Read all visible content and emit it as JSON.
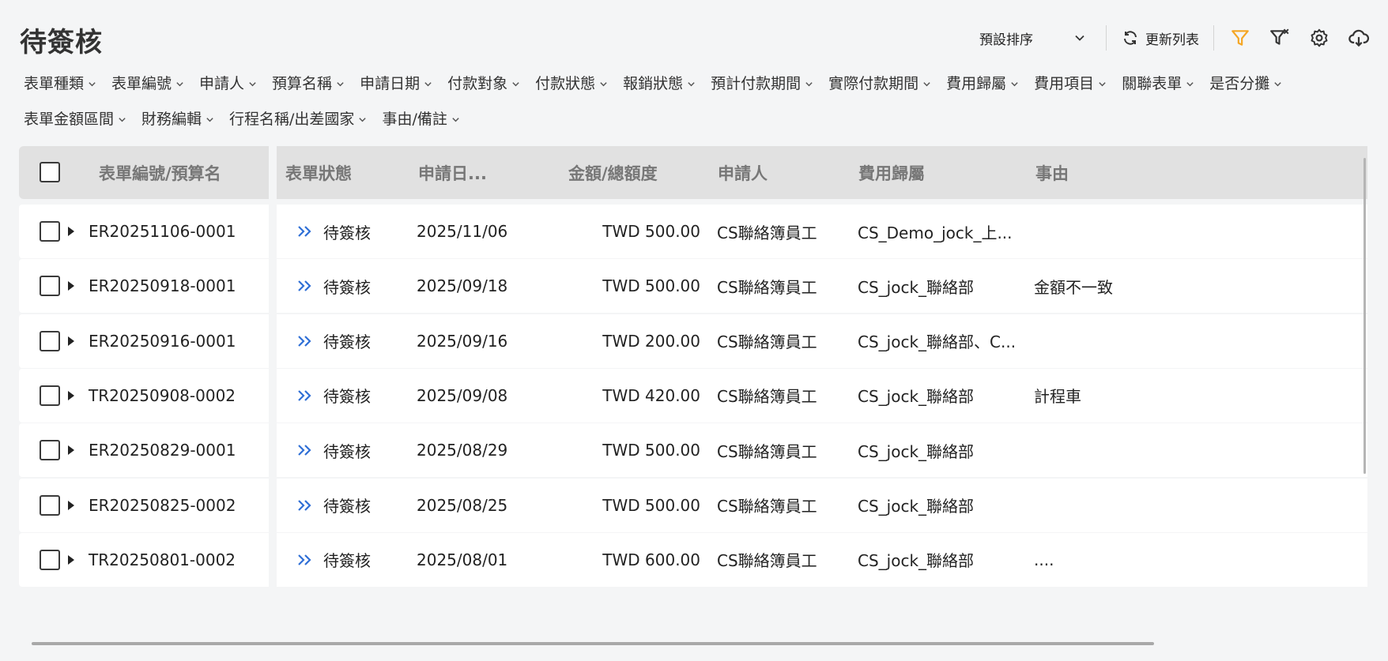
{
  "page": {
    "title": "待簽核"
  },
  "toolbar": {
    "sort_label": "預設排序",
    "refresh_label": "更新列表",
    "icons": [
      "filter-icon",
      "clear-filter-icon",
      "gear-icon",
      "cloud-download-icon"
    ],
    "accent_color": "#f5a623"
  },
  "filters": [
    "表單種類",
    "表單編號",
    "申請人",
    "預算名稱",
    "申請日期",
    "付款對象",
    "付款狀態",
    "報銷狀態",
    "預計付款期間",
    "實際付款期間",
    "費用歸屬",
    "費用項目",
    "關聯表單",
    "是否分攤",
    "表單金額區間",
    "財務編輯",
    "行程名稱/出差國家",
    "事由/備註"
  ],
  "table": {
    "headers": {
      "form_no": "表單編號/預算名",
      "status": "表單狀態",
      "date": "申請日...",
      "amount": "金額/總額度",
      "applicant": "申請人",
      "cost_center": "費用歸屬",
      "reason": "事由"
    },
    "rows": [
      {
        "form_no": "ER20251106-0001",
        "status": "待簽核",
        "date": "2025/11/06",
        "amount": "TWD 500.00",
        "applicant": "CS聯絡簿員工",
        "cost_center": "CS_Demo_jock_上...",
        "reason": ""
      },
      {
        "form_no": "ER20250918-0001",
        "status": "待簽核",
        "date": "2025/09/18",
        "amount": "TWD 500.00",
        "applicant": "CS聯絡簿員工",
        "cost_center": "CS_jock_聯絡部",
        "reason": "金額不一致"
      },
      {
        "form_no": "ER20250916-0001",
        "status": "待簽核",
        "date": "2025/09/16",
        "amount": "TWD 200.00",
        "applicant": "CS聯絡簿員工",
        "cost_center": "CS_jock_聯絡部、C...",
        "reason": ""
      },
      {
        "form_no": "TR20250908-0002",
        "status": "待簽核",
        "date": "2025/09/08",
        "amount": "TWD 420.00",
        "applicant": "CS聯絡簿員工",
        "cost_center": "CS_jock_聯絡部",
        "reason": "計程車"
      },
      {
        "form_no": "ER20250829-0001",
        "status": "待簽核",
        "date": "2025/08/29",
        "amount": "TWD 500.00",
        "applicant": "CS聯絡簿員工",
        "cost_center": "CS_jock_聯絡部",
        "reason": ""
      },
      {
        "form_no": "ER20250825-0002",
        "status": "待簽核",
        "date": "2025/08/25",
        "amount": "TWD 500.00",
        "applicant": "CS聯絡簿員工",
        "cost_center": "CS_jock_聯絡部",
        "reason": ""
      },
      {
        "form_no": "TR20250801-0002",
        "status": "待簽核",
        "date": "2025/08/01",
        "amount": "TWD 600.00",
        "applicant": "CS聯絡簿員工",
        "cost_center": "CS_jock_聯絡部",
        "reason": "...."
      }
    ],
    "status_icon_color": "#2f6fd6"
  }
}
